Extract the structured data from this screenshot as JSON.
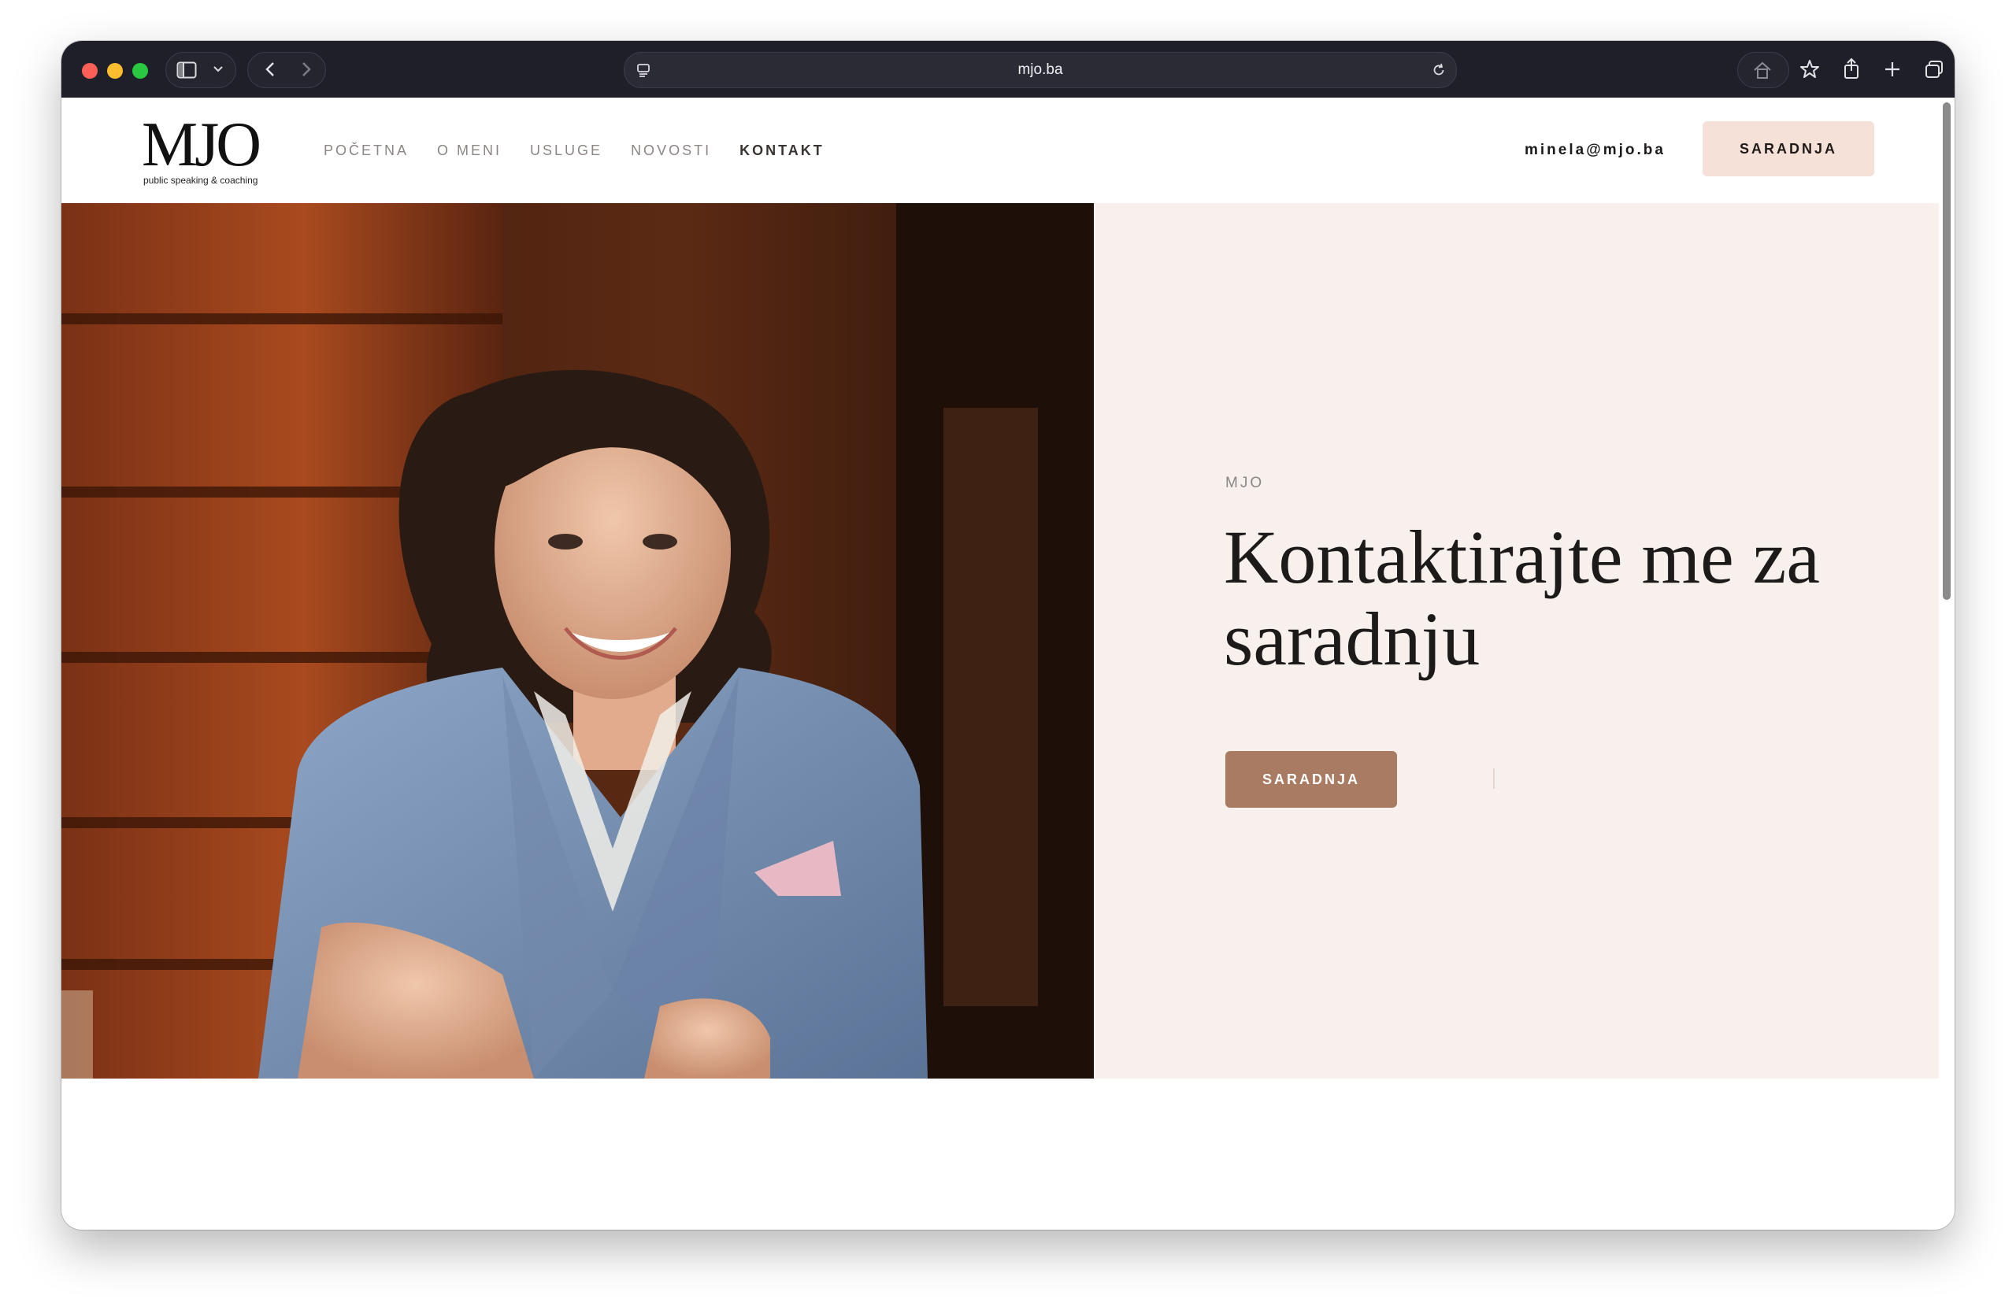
{
  "browser": {
    "url": "mjo.ba",
    "icons": [
      "sidebar-toggle-icon",
      "chevron-down-icon",
      "back-icon",
      "forward-icon",
      "page-menu-icon",
      "reload-icon",
      "home-icon",
      "star-icon",
      "share-icon",
      "new-tab-icon",
      "tabs-overview-icon"
    ]
  },
  "site": {
    "logo": {
      "mark": "MJO",
      "tagline": "public speaking & coaching"
    },
    "nav": [
      {
        "label": "POČETNA",
        "active": false
      },
      {
        "label": "O MENI",
        "active": false
      },
      {
        "label": "USLUGE",
        "active": false
      },
      {
        "label": "NOVOSTI",
        "active": false
      },
      {
        "label": "KONTAKT",
        "active": true
      }
    ],
    "email": "minela@mjo.ba",
    "header_cta": "SARADNJA"
  },
  "hero": {
    "eyebrow": "MJO",
    "headline": "Kontaktirajte me za saradnju",
    "cta": "SARADNJA",
    "photo": "portrait of smiling woman in blue blazer"
  },
  "colors": {
    "header_cta_bg": "#f6e1d8",
    "panel_bg": "#f8f0ed",
    "cta_bg": "#a97b63",
    "browser_chrome": "#1f1f2a"
  }
}
